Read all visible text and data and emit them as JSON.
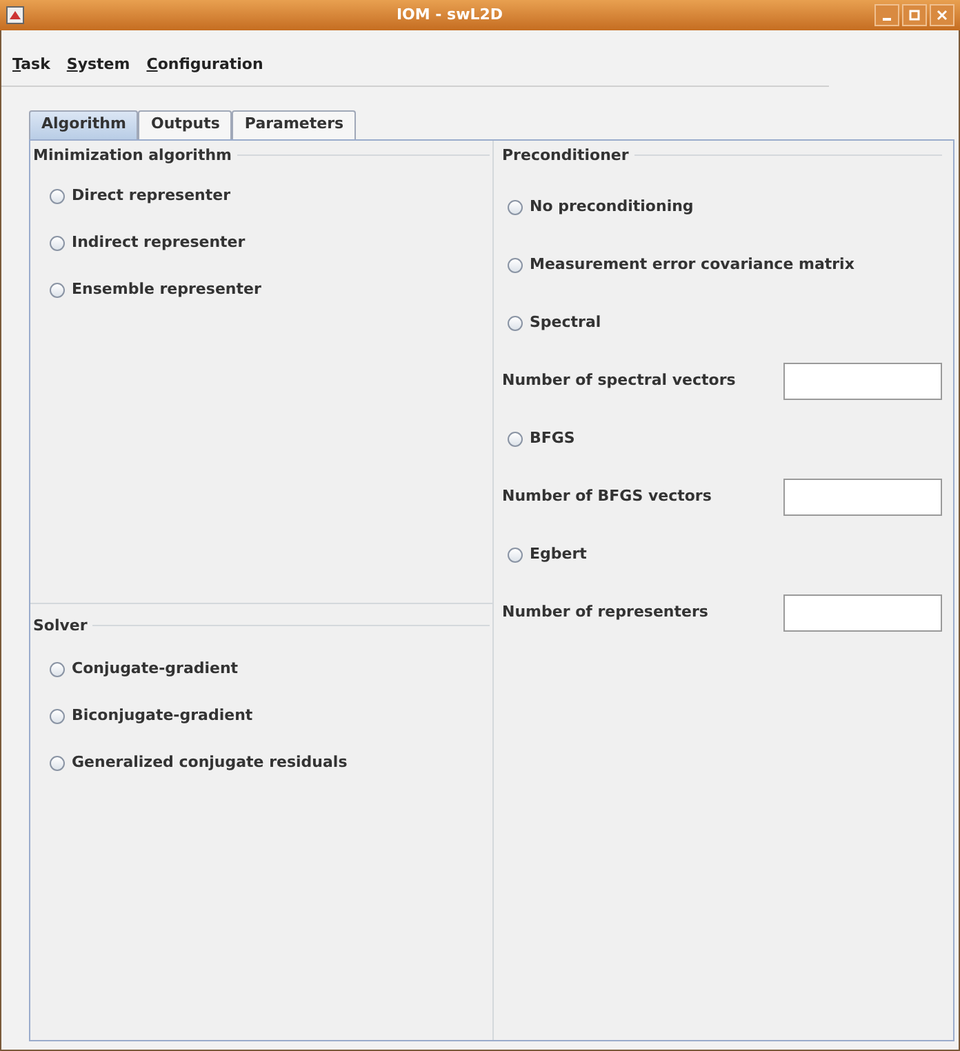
{
  "window": {
    "title": "IOM - swL2D"
  },
  "menu": [
    {
      "label": "Task"
    },
    {
      "label": "System"
    },
    {
      "label": "Configuration"
    }
  ],
  "tabs": [
    {
      "label": "Algorithm",
      "selected": true
    },
    {
      "label": "Outputs",
      "selected": false
    },
    {
      "label": "Parameters",
      "selected": false
    }
  ],
  "minimization": {
    "title": "Minimization algorithm",
    "options": [
      {
        "label": "Direct representer",
        "selected": false
      },
      {
        "label": "Indirect representer",
        "selected": false
      },
      {
        "label": "Ensemble representer",
        "selected": false
      }
    ]
  },
  "solver": {
    "title": "Solver",
    "options": [
      {
        "label": "Conjugate-gradient",
        "selected": false
      },
      {
        "label": "Biconjugate-gradient",
        "selected": false
      },
      {
        "label": "Generalized conjugate residuals",
        "selected": false
      }
    ]
  },
  "preconditioner": {
    "title": "Preconditioner",
    "items": [
      {
        "kind": "radio",
        "label": "No preconditioning",
        "selected": false
      },
      {
        "kind": "radio",
        "label": "Measurement error covariance matrix",
        "selected": false
      },
      {
        "kind": "radio",
        "label": "Spectral",
        "selected": false
      },
      {
        "kind": "field",
        "label": "Number of spectral vectors"
      },
      {
        "kind": "radio",
        "label": "BFGS",
        "selected": false
      },
      {
        "kind": "field",
        "label": "Number of BFGS vectors"
      },
      {
        "kind": "radio",
        "label": "Egbert",
        "selected": false
      },
      {
        "kind": "field",
        "label": "Number of representers"
      }
    ]
  }
}
